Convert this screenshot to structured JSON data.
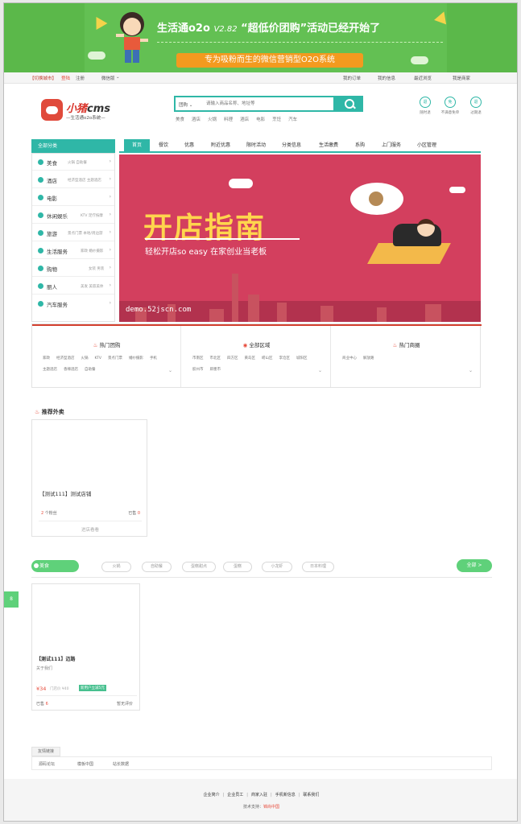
{
  "banner": {
    "title": "生活通o2o",
    "version": "V2.82",
    "headline": "“超低价团购”活动已经开始了",
    "subline": "专为吸粉而生的微信营销型O2O系统"
  },
  "topbar": {
    "city": "【切换城市】",
    "login": "登陆",
    "register": "注册",
    "wechat": "微信版",
    "my_orders": "我的订单",
    "my_info": "我的信息",
    "recent": "最近浏览",
    "merchant": "我是商家"
  },
  "logo": {
    "name_a": "小猪",
    "name_b": "cms",
    "slogan": "—生活通o2o系统—"
  },
  "search": {
    "category": "团购",
    "placeholder": "请输入商品名称、地址等",
    "hotwords": [
      "美食",
      "酒店",
      "火锅",
      "料理",
      "酒店",
      "电影",
      "烹饪",
      "汽车"
    ]
  },
  "header_icons": [
    {
      "glyph": "退",
      "label": "随时退"
    },
    {
      "glyph": "免",
      "label": "不满意免单"
    },
    {
      "glyph": "退",
      "label": "过期退"
    }
  ],
  "nav": {
    "all_categories": "全部分类",
    "tabs": [
      "首页",
      "餐饮",
      "优惠",
      "附近优惠",
      "限时活动",
      "分类信息",
      "生活缴费",
      "系购",
      "上门服务",
      "小区管理"
    ]
  },
  "sidebar": [
    {
      "label": "美食",
      "sub": "火锅  自助餐"
    },
    {
      "label": "酒店",
      "sub": "经济型酒店  主题酒店"
    },
    {
      "label": "电影",
      "sub": ""
    },
    {
      "label": "休闲娱乐",
      "sub": "KTV  足疗按摩"
    },
    {
      "label": "旅游",
      "sub": "景点门票  本地/周边游"
    },
    {
      "label": "生活服务",
      "sub": "家政  婚纱摄影"
    },
    {
      "label": "购物",
      "sub": "女装  男装"
    },
    {
      "label": "丽人",
      "sub": "美发  美容美体"
    },
    {
      "label": "汽车服务",
      "sub": ""
    }
  ],
  "hero": {
    "title": "开店指南",
    "subtitle": "轻松开店so easy  在家创业当老板",
    "watermark": "demo.52jscn.com"
  },
  "panels": [
    {
      "title": "热门团购",
      "links": [
        "家政",
        "经济型酒店",
        "火锅",
        "KTV",
        "景点门票",
        "婚纱摄影",
        "手机",
        "主题酒店",
        "香辣酒店",
        "自助餐"
      ]
    },
    {
      "title": "全部区域",
      "links": [
        "市南区",
        "市北区",
        "四方区",
        "黄岛区",
        "崂山区",
        "李沧区",
        "城阳区",
        "胶州市",
        "即墨市"
      ]
    },
    {
      "title": "热门商圈",
      "links": [
        "商业中心",
        "解放路"
      ]
    }
  ],
  "recommended": {
    "title": "推荐外卖",
    "shop_name": "【测试111】测试店铺",
    "fans_count": "2",
    "fans_label": "个粉丝",
    "sold_label": "已售",
    "sold_count": "0",
    "action": "进店看看"
  },
  "food": {
    "active": "美食",
    "pills": [
      "火锅",
      "自助餐",
      "蛋糕甜点",
      "蛋糕",
      "小龙虾",
      "日本料理"
    ],
    "all": "全部 >",
    "side_tab": "8"
  },
  "deal": {
    "name": "【测试111】迈路",
    "location": "关于我们",
    "price": "¥34",
    "original": "门店价 ¥40",
    "tag": "新用户立减5元",
    "sold_label": "已售",
    "sold_count": "6",
    "reviews": "暂无评价"
  },
  "friend_links": {
    "title": "友情链接",
    "items": [
      "源码论坛",
      "模板中国",
      "站长数据"
    ]
  },
  "footer": {
    "links": [
      "企业简介",
      "企业员工",
      "商家入驻",
      "手机新信息",
      "联系我们"
    ],
    "support_label": "技术支持：",
    "support_name": "锦尚中国"
  }
}
